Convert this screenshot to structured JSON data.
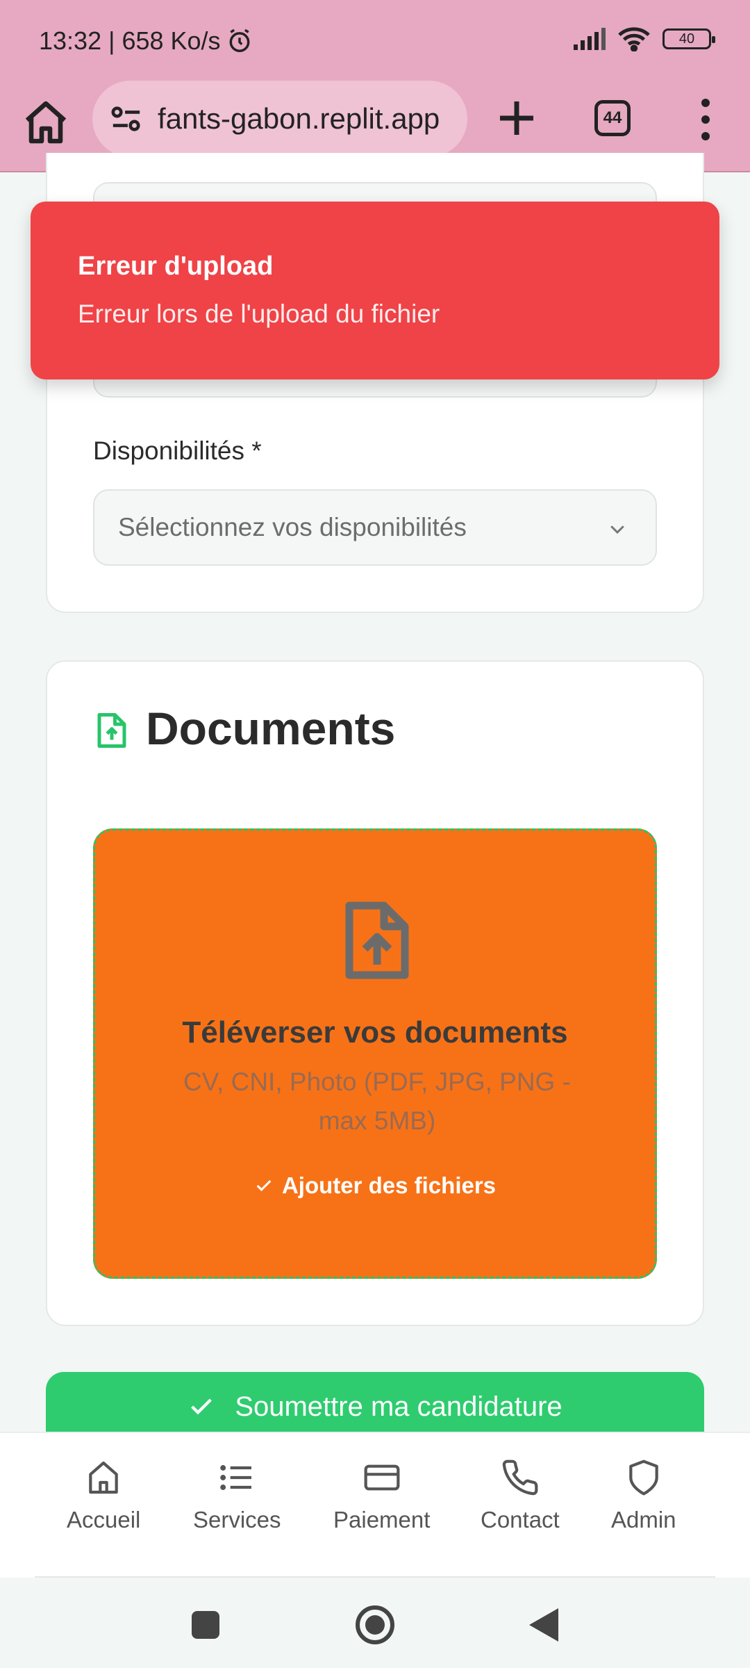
{
  "status_bar": {
    "time_speed": "13:32 | 658 Ko/s",
    "battery": "40"
  },
  "browser": {
    "url": "fants-gabon.replit.app",
    "tab_count": "44"
  },
  "form": {
    "availability_label": "Disponibilités *",
    "availability_placeholder": "Sélectionnez vos disponibilités"
  },
  "documents": {
    "title": "Documents",
    "upload_title": "Téléverser vos documents",
    "upload_subtitle": "CV, CNI, Photo (PDF, JPG, PNG - max 5MB)",
    "add_files_label": "Ajouter des fichiers"
  },
  "submit": {
    "label": "Soumettre ma candidature"
  },
  "toast": {
    "title": "Erreur d'upload",
    "message": "Erreur lors de l'upload du fichier"
  },
  "bottom_nav": {
    "items": [
      {
        "label": "Accueil",
        "icon": "home-icon"
      },
      {
        "label": "Services",
        "icon": "list-icon"
      },
      {
        "label": "Paiement",
        "icon": "credit-card-icon"
      },
      {
        "label": "Contact",
        "icon": "phone-icon"
      },
      {
        "label": "Admin",
        "icon": "shield-icon"
      }
    ]
  },
  "colors": {
    "status_bar": "#e6a9c1",
    "toast": "#ef4347",
    "upload_zone": "#f77217",
    "submit": "#2ecc6f",
    "accent_green": "#27c46a"
  }
}
